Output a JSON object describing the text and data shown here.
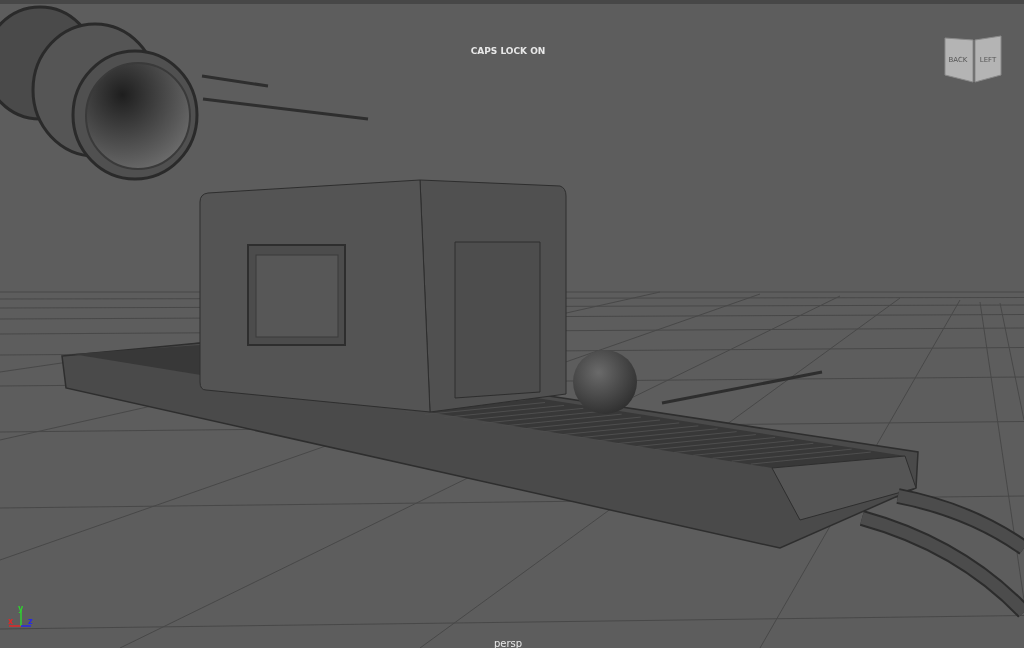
{
  "viewport": {
    "hud_message": "CAPS LOCK ON",
    "camera_name": "persp",
    "view_cube": {
      "faces": [
        {
          "label": "BACK",
          "kind": "front"
        },
        {
          "label": "LEFT",
          "kind": "side"
        }
      ]
    },
    "axis_gizmo": [
      {
        "label": "x",
        "kind": "x",
        "color": "#e02828"
      },
      {
        "label": "y",
        "kind": "y",
        "color": "#30d030"
      },
      {
        "label": "z",
        "kind": "z",
        "color": "#2828e8"
      }
    ]
  }
}
